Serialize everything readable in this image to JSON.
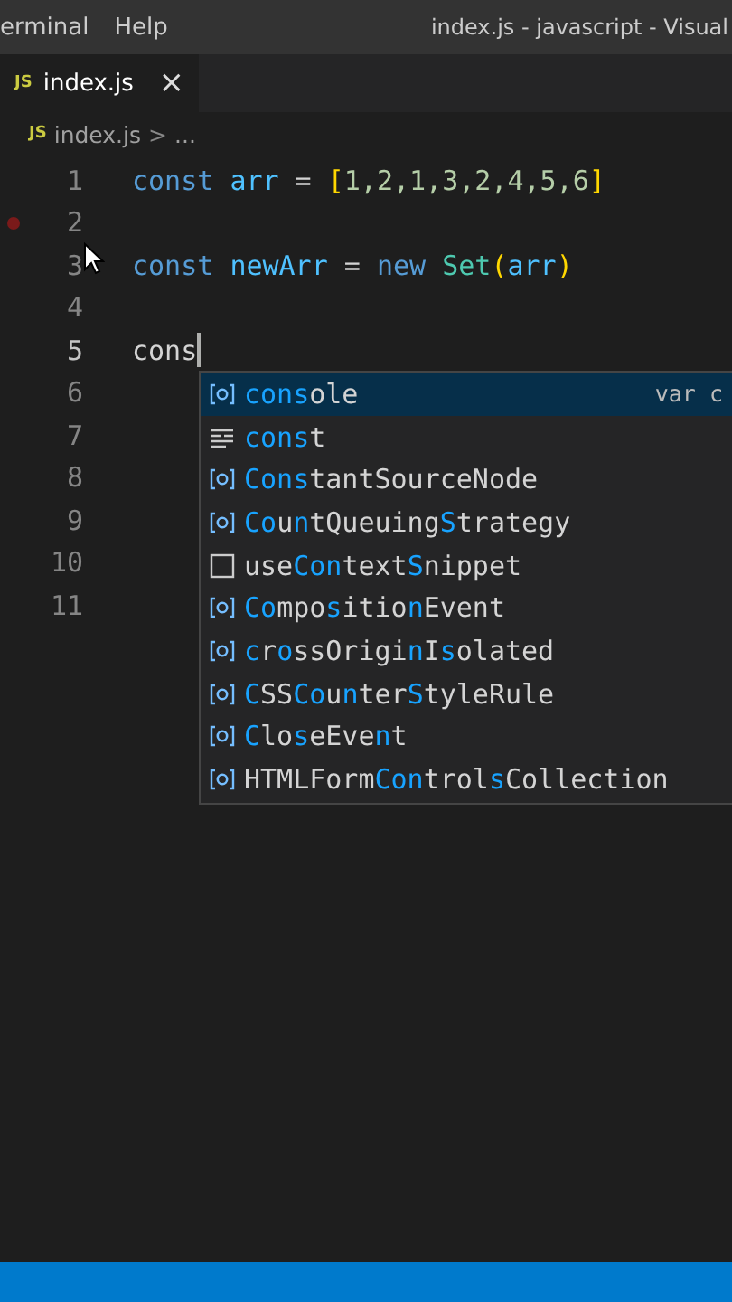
{
  "menu": [
    "erminal",
    "Help"
  ],
  "window": {
    "title": "index.js - javascript - Visual"
  },
  "tabs": [
    {
      "label": "index.js",
      "file_icon": "JS",
      "close": "×",
      "selected": true
    }
  ],
  "breadcrumb": {
    "file_icon": "JS",
    "file": "index.js",
    "separator": ">",
    "rest": "..."
  },
  "lines": [
    {
      "number": "1",
      "breakpoint": false,
      "current": false,
      "tokens": [
        {
          "text": "const ",
          "kind": "keyword"
        },
        {
          "text": "arr",
          "kind": "variable"
        },
        {
          "text": " = "
        },
        {
          "text": "[",
          "kind": "bracket"
        },
        {
          "text": "1,2,1,3,2,4,5,6",
          "kind": "number"
        },
        {
          "text": "]",
          "kind": "bracket"
        }
      ]
    },
    {
      "number": "2",
      "breakpoint": true,
      "current": false
    },
    {
      "number": "3",
      "breakpoint": false,
      "current": false,
      "tokens": [
        {
          "text": "const ",
          "kind": "keyword"
        },
        {
          "text": "newArr",
          "kind": "variable"
        },
        {
          "text": " = "
        },
        {
          "text": "new ",
          "kind": "keyword"
        },
        {
          "text": "Set",
          "kind": "class"
        },
        {
          "text": "(",
          "kind": "bracket"
        },
        {
          "text": "arr",
          "kind": "variable"
        },
        {
          "text": ")",
          "kind": "bracket"
        }
      ]
    },
    {
      "number": "4",
      "breakpoint": false,
      "current": false
    },
    {
      "number": "5",
      "breakpoint": false,
      "current": true,
      "tokens": [
        {
          "text": "cons"
        }
      ]
    },
    {
      "number": "6",
      "breakpoint": false,
      "current": false
    },
    {
      "number": "7",
      "breakpoint": false,
      "current": false
    },
    {
      "number": "8",
      "breakpoint": false,
      "current": false
    },
    {
      "number": "9",
      "breakpoint": false,
      "current": false
    },
    {
      "number": "10",
      "breakpoint": false,
      "current": false
    },
    {
      "number": "11",
      "breakpoint": false,
      "current": false
    }
  ],
  "suggestions": [
    {
      "label": "**cons**ole",
      "kind": "variable",
      "selected": true,
      "detail": "var c"
    },
    {
      "label": "**cons**t",
      "kind": "keyword",
      "selected": false
    },
    {
      "label": "**Cons**tantSourceNode",
      "kind": "variable",
      "selected": false
    },
    {
      "label": "**Co**u**n**tQueuing**S**trategy",
      "kind": "variable",
      "selected": false
    },
    {
      "label": "use**Con**text**S**nippet",
      "kind": "snippet",
      "selected": false
    },
    {
      "label": "**Co**mpo**s**itio**n**Event",
      "kind": "variable",
      "selected": false
    },
    {
      "label": "**c**r**o**ssOrigi**n**I**s**olated",
      "kind": "variable",
      "selected": false
    },
    {
      "label": "**C**SS**Co**u**n**ter**S**tyleRule",
      "kind": "variable",
      "selected": false
    },
    {
      "label": "**C**lo**s**eEve**n**t",
      "kind": "variable",
      "selected": false
    },
    {
      "label": "HTMLForm**Con**trol**s**Collection",
      "kind": "variable",
      "selected": false
    }
  ]
}
